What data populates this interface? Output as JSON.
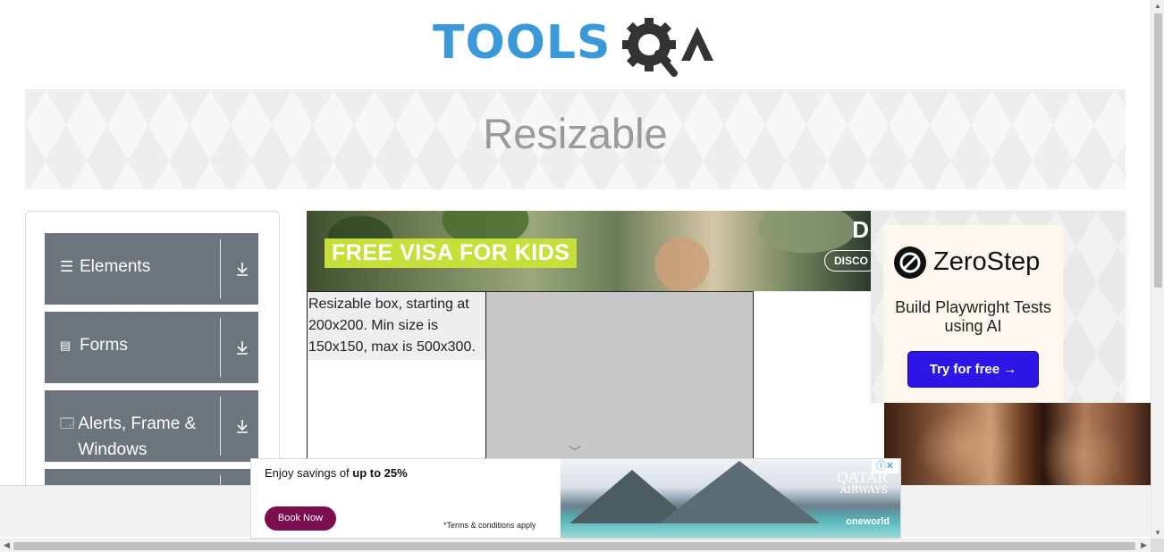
{
  "logo": {
    "text_tools": "TOOLS",
    "text_a": "A",
    "icon": "gear-magnifier-icon"
  },
  "banner": {
    "title": "Resizable"
  },
  "sidebar": {
    "groups": [
      {
        "label": "Elements",
        "icon": "hamburger-icon",
        "action_icon": "download-icon"
      },
      {
        "label": "Forms",
        "icon": "document-icon",
        "action_icon": "download-icon"
      },
      {
        "label": "Alerts, Frame & Windows",
        "icon": "window-icon",
        "action_icon": "download-icon"
      }
    ]
  },
  "ad_top": {
    "headline": "FREE VISA FOR KIDS",
    "corner_text": "D",
    "button": "DISCO"
  },
  "resizable": {
    "text": "Resizable box, starting at 200x200. Min size is 150x150, max is 500x300."
  },
  "ad_right": {
    "brand": "ZeroStep",
    "headline": "Build Playwright Tests using AI",
    "button": "Try for free →"
  },
  "ad_bottom": {
    "savings_prefix": "Enjoy savings of ",
    "savings_bold": "up to 25%",
    "book_button": "Book Now",
    "terms": "*Terms & conditions apply",
    "airline_line1": "QATAR",
    "airline_line2": "AIRWAYS",
    "alliance": "oneworld",
    "adchoice": "ⓘ✕"
  },
  "colors": {
    "tools_blue": "#3a9ad9",
    "sidebar_grey": "#6c757d",
    "zs_button": "#2d16e6",
    "book_button": "#7a0e4f",
    "visa_green": "#c6e03b"
  }
}
